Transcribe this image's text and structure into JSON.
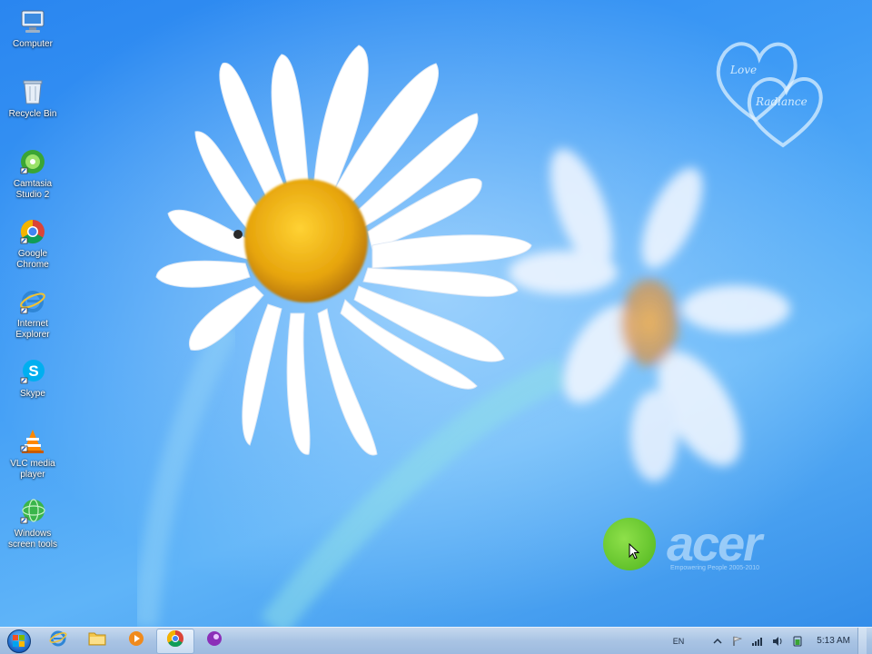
{
  "desktop": {
    "icons": [
      {
        "id": "computer",
        "label": "Computer",
        "icon": "computer-icon"
      },
      {
        "id": "recycle-bin",
        "label": "Recycle Bin",
        "icon": "recycle-bin-icon"
      },
      {
        "id": "camtasia",
        "label": "Camtasia\nStudio 2",
        "icon": "camtasia-icon"
      },
      {
        "id": "google-chrome",
        "label": "Google\nChrome",
        "icon": "chrome-icon"
      },
      {
        "id": "internet-explorer",
        "label": "Internet\nExplorer",
        "icon": "ie-icon"
      },
      {
        "id": "skype",
        "label": "Skype",
        "icon": "skype-icon"
      },
      {
        "id": "vlc",
        "label": "VLC media\nplayer",
        "icon": "vlc-icon"
      },
      {
        "id": "windows-screen-tools",
        "label": "Windows\nscreen tools",
        "icon": "globe-icon"
      }
    ]
  },
  "brand": {
    "acer_text": "acer",
    "acer_sub": "Empowering People  2005-2010",
    "hearts_text_1": "Love",
    "hearts_text_2": "Radiance"
  },
  "taskbar": {
    "buttons": [
      {
        "id": "ie",
        "icon": "ie-icon"
      },
      {
        "id": "explorer",
        "icon": "folder-icon"
      },
      {
        "id": "media",
        "icon": "media-player-icon"
      },
      {
        "id": "chrome",
        "icon": "chrome-icon",
        "active": true
      },
      {
        "id": "app",
        "icon": "purple-app-icon"
      }
    ],
    "tray": {
      "language": "EN",
      "clock": "5:13 AM"
    }
  },
  "colors": {
    "sky": "#3d9af5",
    "acer_green": "#5fc22a",
    "taskbar": "#b5cde9"
  }
}
